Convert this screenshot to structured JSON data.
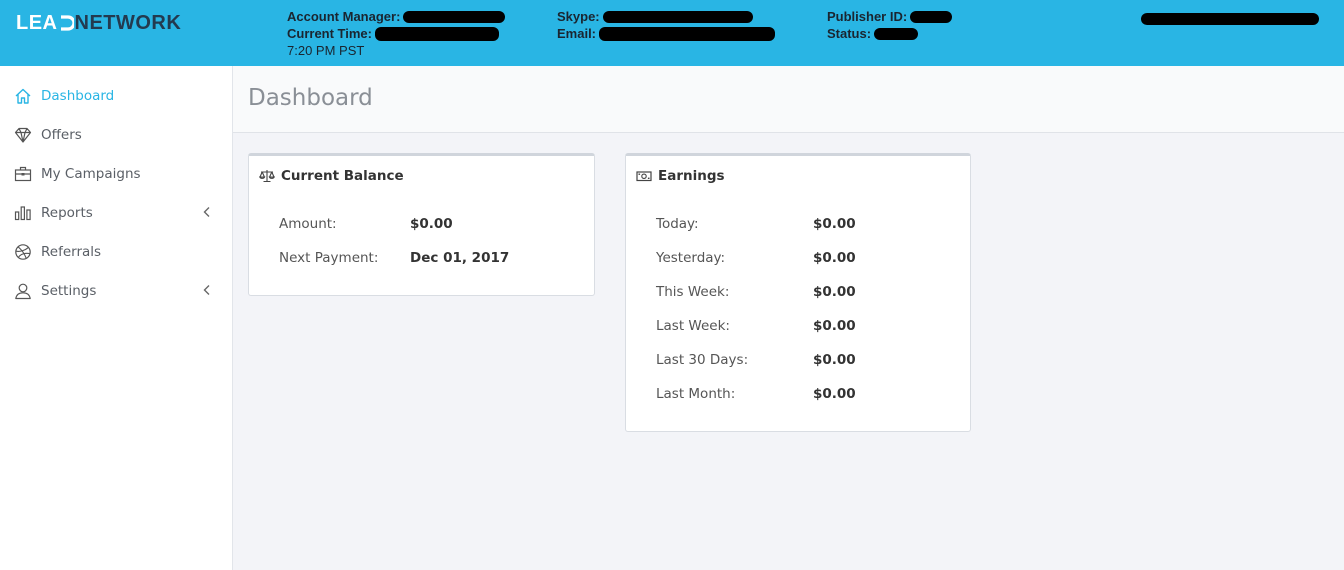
{
  "brand": {
    "part1": "LEA",
    "part2": "NETWORK",
    "white": "#ffffff",
    "dark": "#233a4f"
  },
  "header": {
    "account_manager_label": "Account Manager:",
    "current_time_label": "Current Time:",
    "current_time_value": "7:20 PM PST",
    "skype_label": "Skype:",
    "email_label": "Email:",
    "publisher_id_label": "Publisher ID:",
    "status_label": "Status:",
    "bg_color": "#29b5e4"
  },
  "sidebar": {
    "items": [
      {
        "label": "Dashboard",
        "icon": "home-icon",
        "active": true
      },
      {
        "label": "Offers",
        "icon": "diamond-icon"
      },
      {
        "label": "My Campaigns",
        "icon": "briefcase-icon"
      },
      {
        "label": "Reports",
        "icon": "bar-chart-icon",
        "submenu": true
      },
      {
        "label": "Referrals",
        "icon": "dribbble-icon"
      },
      {
        "label": "Settings",
        "icon": "user-icon",
        "submenu": true
      }
    ],
    "active_color": "#29b5e4"
  },
  "page": {
    "title": "Dashboard"
  },
  "balance": {
    "title": "Current Balance",
    "icon": "balance-scale-icon",
    "rows": [
      {
        "label": "Amount:",
        "value": "$0.00"
      },
      {
        "label": "Next Payment:",
        "value": "Dec 01, 2017"
      }
    ]
  },
  "earnings": {
    "title": "Earnings",
    "icon": "money-icon",
    "rows": [
      {
        "label": "Today:",
        "value": "$0.00"
      },
      {
        "label": "Yesterday:",
        "value": "$0.00"
      },
      {
        "label": "This Week:",
        "value": "$0.00"
      },
      {
        "label": "Last Week:",
        "value": "$0.00"
      },
      {
        "label": "Last 30 Days:",
        "value": "$0.00"
      },
      {
        "label": "Last Month:",
        "value": "$0.00"
      }
    ]
  }
}
